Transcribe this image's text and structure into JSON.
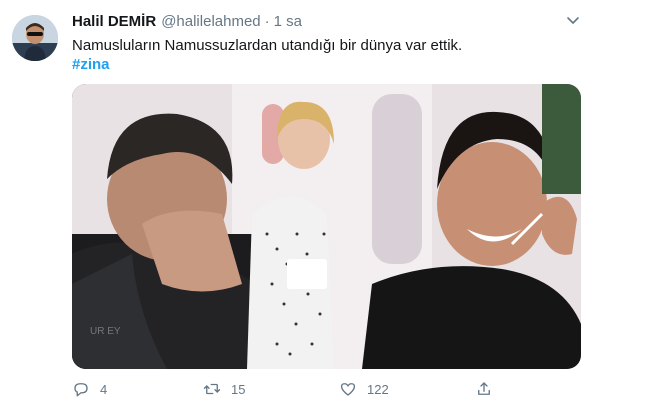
{
  "tweet": {
    "display_name": "Halil DEMİR",
    "handle": "@halilelahmed",
    "separator": "·",
    "time": "1 sa",
    "text": "Namusluların Namussuzlardan utandığı bir dünya var ettik.",
    "hashtag": "#zina",
    "media": {
      "description_icons": [
        "crying-man",
        "tv-presenter",
        "laughing-woman"
      ]
    },
    "actions": {
      "reply_count": "4",
      "retweet_count": "15",
      "like_count": "122",
      "reply_icon": "reply-icon",
      "retweet_icon": "retweet-icon",
      "like_icon": "heart-icon",
      "share_icon": "share-icon"
    }
  },
  "colors": {
    "text": "#14171a",
    "secondary": "#657786",
    "link": "#1da1f2"
  }
}
